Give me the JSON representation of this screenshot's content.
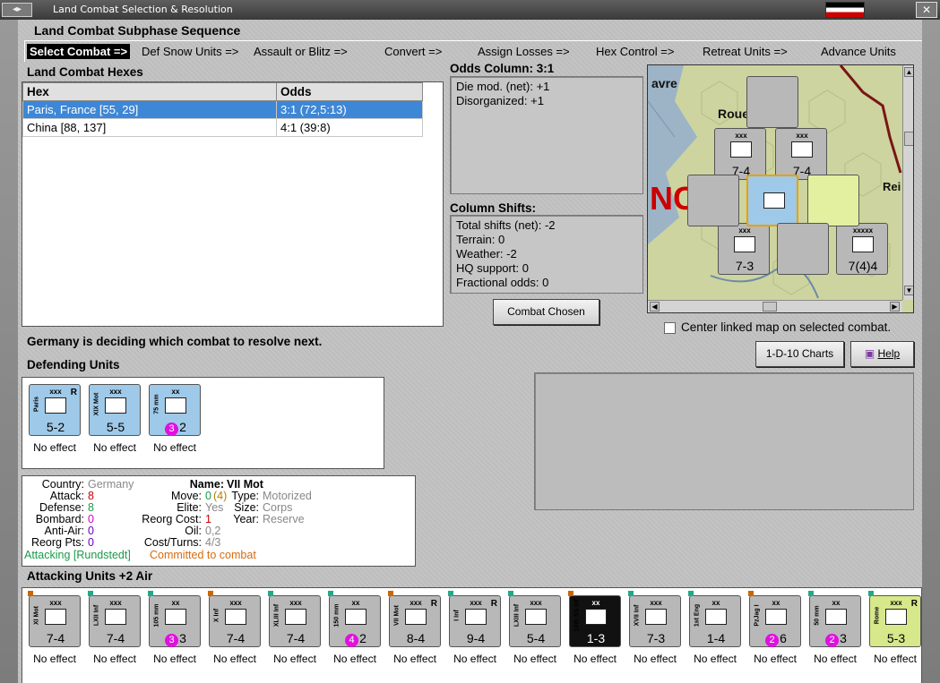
{
  "window": {
    "title": "Land Combat Selection & Resolution"
  },
  "subphase": {
    "title": "Land Combat Subphase Sequence",
    "steps": [
      "Select Combat =>",
      "Def Snow Units =>",
      "Assault or Blitz =>",
      "Convert =>",
      "Assign Losses =>",
      "Hex Control =>",
      "Retreat Units =>",
      "Advance Units"
    ]
  },
  "hexes": {
    "title": "Land Combat Hexes",
    "headers": [
      "Hex",
      "Odds"
    ],
    "rows": [
      {
        "hex": "Paris, France [55, 29]",
        "odds": "3:1 (72,5:13)"
      },
      {
        "hex": "China [88, 137]",
        "odds": "4:1 (39:8)"
      }
    ]
  },
  "odds": {
    "title": "Odds Column: 3:1",
    "lines": [
      "Die mod. (net): +1",
      "Disorganized: +1"
    ]
  },
  "shifts": {
    "title": "Column Shifts:",
    "lines": [
      "Total shifts (net): -2",
      "Terrain: 0",
      "Weather: -2",
      "HQ support: 0",
      "Fractional odds: 0"
    ]
  },
  "buttons": {
    "combat_chosen": "Combat Chosen",
    "charts": "1-D-10 Charts",
    "help": "Help"
  },
  "map": {
    "center_label": "Center linked map on selected combat.",
    "labels": [
      "avre",
      "Roue",
      "NC",
      "Rei"
    ],
    "counters": [
      {
        "size": "xxx",
        "val": "7-4"
      },
      {
        "size": "xxx",
        "val": "7-4"
      },
      {
        "size": "xxx",
        "val": "7-3"
      },
      {
        "size": "xxxxx",
        "val": "7(4)4"
      }
    ]
  },
  "status": "Germany is deciding which combat to resolve next.",
  "defending": {
    "title": "Defending Units",
    "units": [
      {
        "size": "xxx",
        "name": "Paris",
        "flag": "R",
        "val": "5-2",
        "effect": "No effect"
      },
      {
        "size": "xxx",
        "name": "XIX Mot",
        "flag": "",
        "val": "5-5",
        "effect": "No effect"
      },
      {
        "size": "xx",
        "name": "75 mm",
        "flag": "",
        "val": "2",
        "badge": "3",
        "effect": "No effect"
      }
    ]
  },
  "unit_info": {
    "country_label": "Country:",
    "country": "Germany",
    "attack_label": "Attack:",
    "attack": "8",
    "defense_label": "Defense:",
    "defense": "8",
    "bombard_label": "Bombard:",
    "bombard": "0",
    "antiair_label": "Anti-Air:",
    "antiair": "0",
    "reorg_label": "Reorg Pts:",
    "reorg": "0",
    "name_label": "Name:",
    "name": "VII Mot",
    "move_label": "Move:",
    "move": "0",
    "move_paren": "(4)",
    "type_label": "Type:",
    "type": "Motorized",
    "elite_label": "Elite:",
    "elite": "Yes",
    "size_label": "Size:",
    "size": "Corps",
    "reorgcost_label": "Reorg Cost:",
    "reorgcost": "1",
    "year_label": "Year:",
    "year": "Reserve",
    "oil_label": "Oil:",
    "oil": "0,2",
    "cost_label": "Cost/Turns:",
    "cost": "4/3",
    "attacking": "Attacking [Rundstedt]",
    "committed": "Committed to combat"
  },
  "attacking": {
    "title": "Attacking Units +2 Air",
    "units": [
      {
        "size": "xxx",
        "name": "XI Mot",
        "val": "7-4",
        "effect": "No effect"
      },
      {
        "size": "xxx",
        "name": "LXII Inf",
        "val": "7-4",
        "effect": "No effect"
      },
      {
        "size": "xx",
        "name": "105 mm",
        "val": "3",
        "badge": "3",
        "effect": "No effect"
      },
      {
        "size": "xxx",
        "name": "X Inf",
        "val": "7-4",
        "effect": "No effect"
      },
      {
        "size": "xxx",
        "name": "XLIII Inf",
        "val": "7-4",
        "effect": "No effect"
      },
      {
        "size": "xx",
        "name": "150 mm",
        "val": "2",
        "badge": "4",
        "effect": "No effect"
      },
      {
        "size": "xxx",
        "name": "VII Mot",
        "flag": "R",
        "val": "8-4",
        "effect": "No effect"
      },
      {
        "size": "xxx",
        "name": "I Inf",
        "flag": "R",
        "val": "9-4",
        "effect": "No effect"
      },
      {
        "size": "xxx",
        "name": "LXIII Inf",
        "val": "5-4",
        "effect": "No effect"
      },
      {
        "size": "xx",
        "name": "10th SS Inf",
        "val": "1-3",
        "effect": "No effect"
      },
      {
        "size": "xxx",
        "name": "XVII Inf",
        "val": "7-3",
        "effect": "No effect"
      },
      {
        "size": "xx",
        "name": "1st Eng",
        "val": "1-4",
        "effect": "No effect"
      },
      {
        "size": "xx",
        "name": "PzJag I",
        "val": "6",
        "badge": "2",
        "effect": "No effect"
      },
      {
        "size": "xx",
        "name": "50 mm",
        "val": "3",
        "badge": "2",
        "effect": "No effect"
      },
      {
        "size": "xxx",
        "name": "Rome",
        "flag": "R",
        "val": "5-3",
        "effect": "No effect"
      }
    ]
  },
  "colors": {
    "selection": "#3d87d6",
    "green": "#1a9a4a",
    "orange": "#d86a10",
    "red": "#cc0000",
    "purple": "#9a00c8",
    "magenta": "#e010e0"
  }
}
